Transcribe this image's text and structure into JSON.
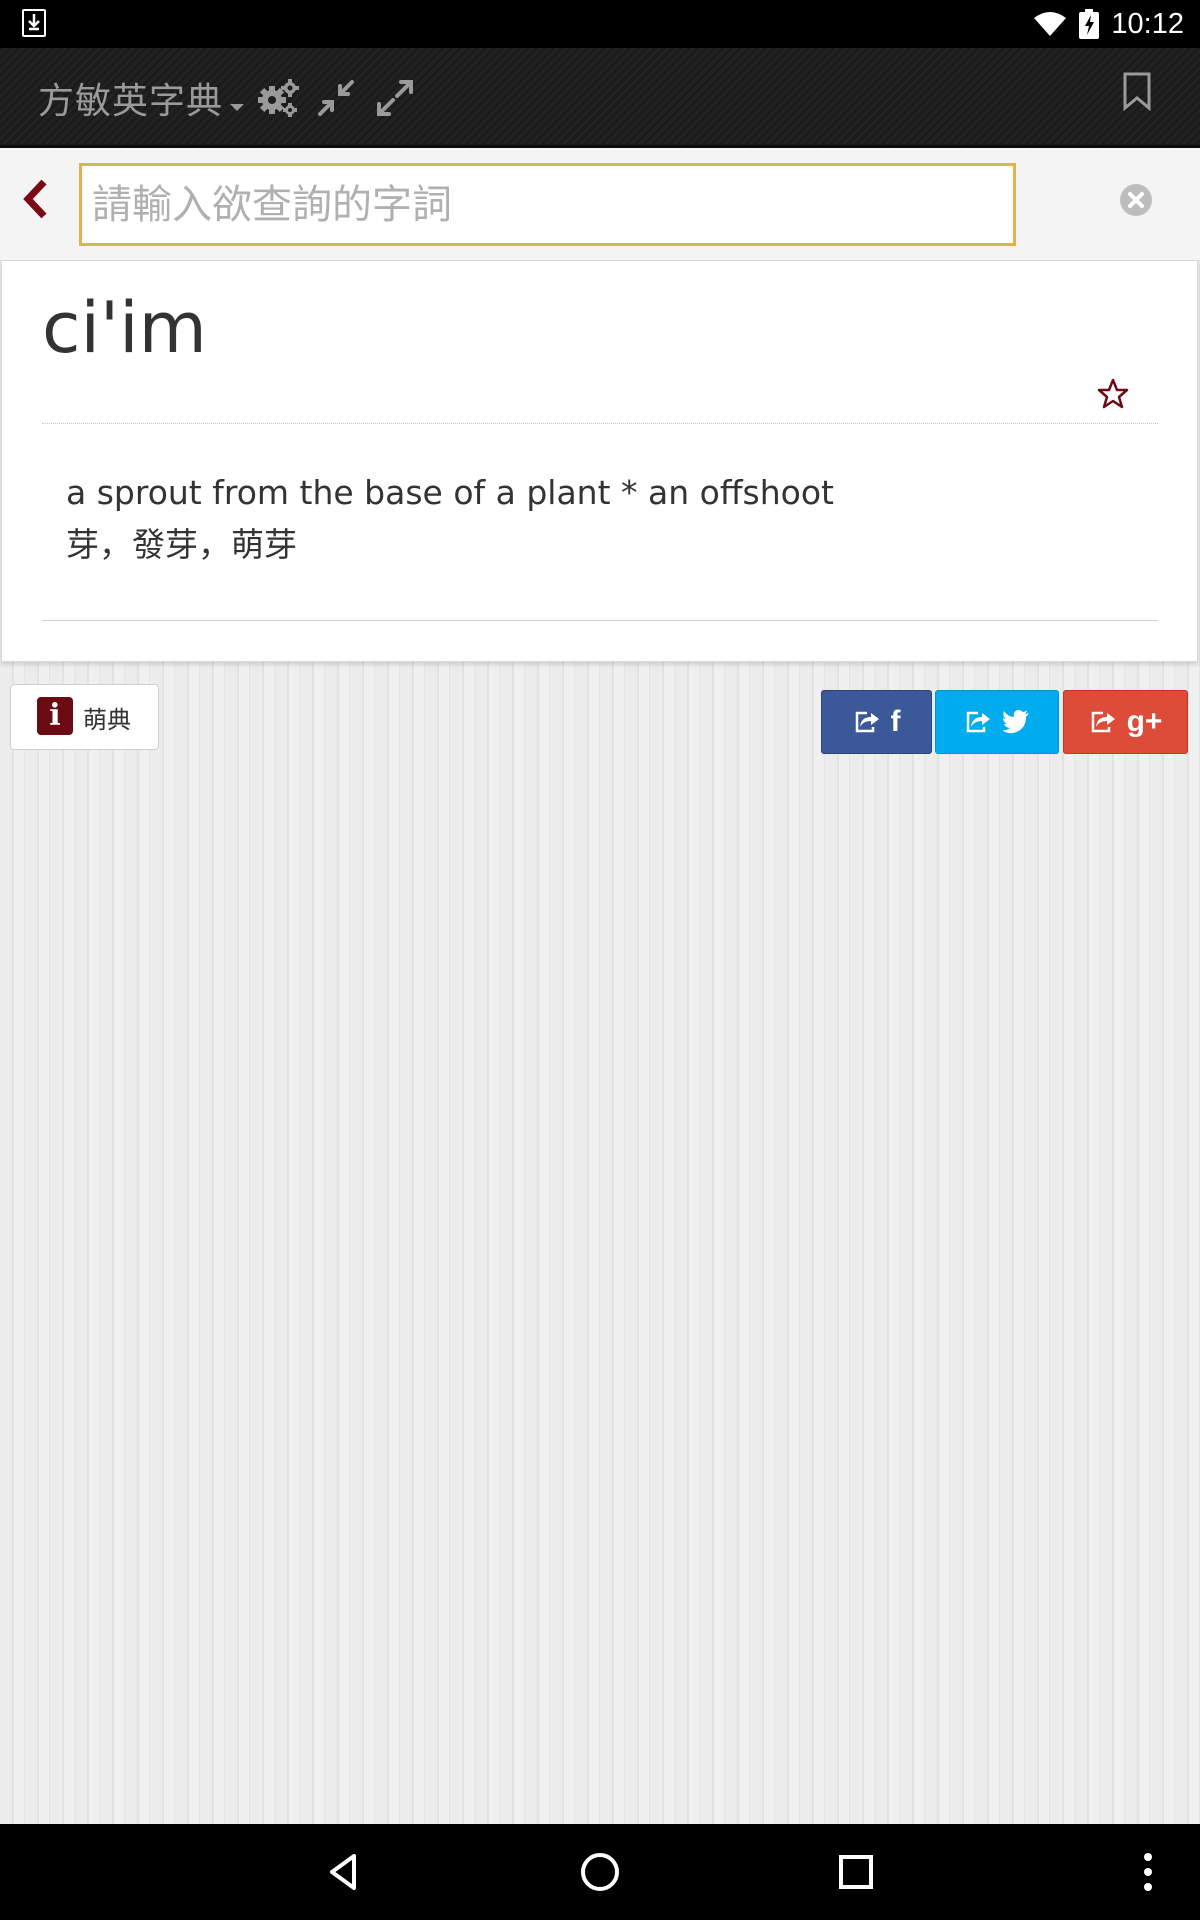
{
  "status_bar": {
    "time": "10:12",
    "icons": [
      "download-icon",
      "wifi-icon",
      "battery-charging-icon"
    ]
  },
  "app_bar": {
    "title": "方敏英字典",
    "icons": [
      "dropdown-caret-icon",
      "gears-icon",
      "compress-icon",
      "expand-icon",
      "bookmark-icon"
    ]
  },
  "search": {
    "placeholder": "請輸入欲查詢的字詞",
    "value": "",
    "icons": [
      "back-chevron-icon",
      "clear-icon"
    ]
  },
  "entry": {
    "headword": "ci'im",
    "definition_en": "a sprout from the base of a plant * an offshoot",
    "definition_zh": "芽，發芽，萌芽",
    "favorite_icon": "star-outline-icon"
  },
  "info_button": {
    "badge": "i",
    "label": "萌典"
  },
  "share": {
    "facebook": {
      "glyph": "f",
      "icon": "share-icon",
      "color": "#3b5998"
    },
    "twitter": {
      "glyph": "twitter-bird-icon",
      "icon": "share-icon",
      "color": "#00aced"
    },
    "googleplus": {
      "glyph": "g+",
      "icon": "share-icon",
      "color": "#dd4b39"
    }
  },
  "nav_bar": {
    "icons": [
      "back-icon",
      "home-icon",
      "recents-icon",
      "overflow-menu-icon"
    ]
  },
  "colors": {
    "accent_dark_red": "#6b0c15",
    "search_border": "#e3b04b",
    "app_bar": "#1e1e1e"
  }
}
